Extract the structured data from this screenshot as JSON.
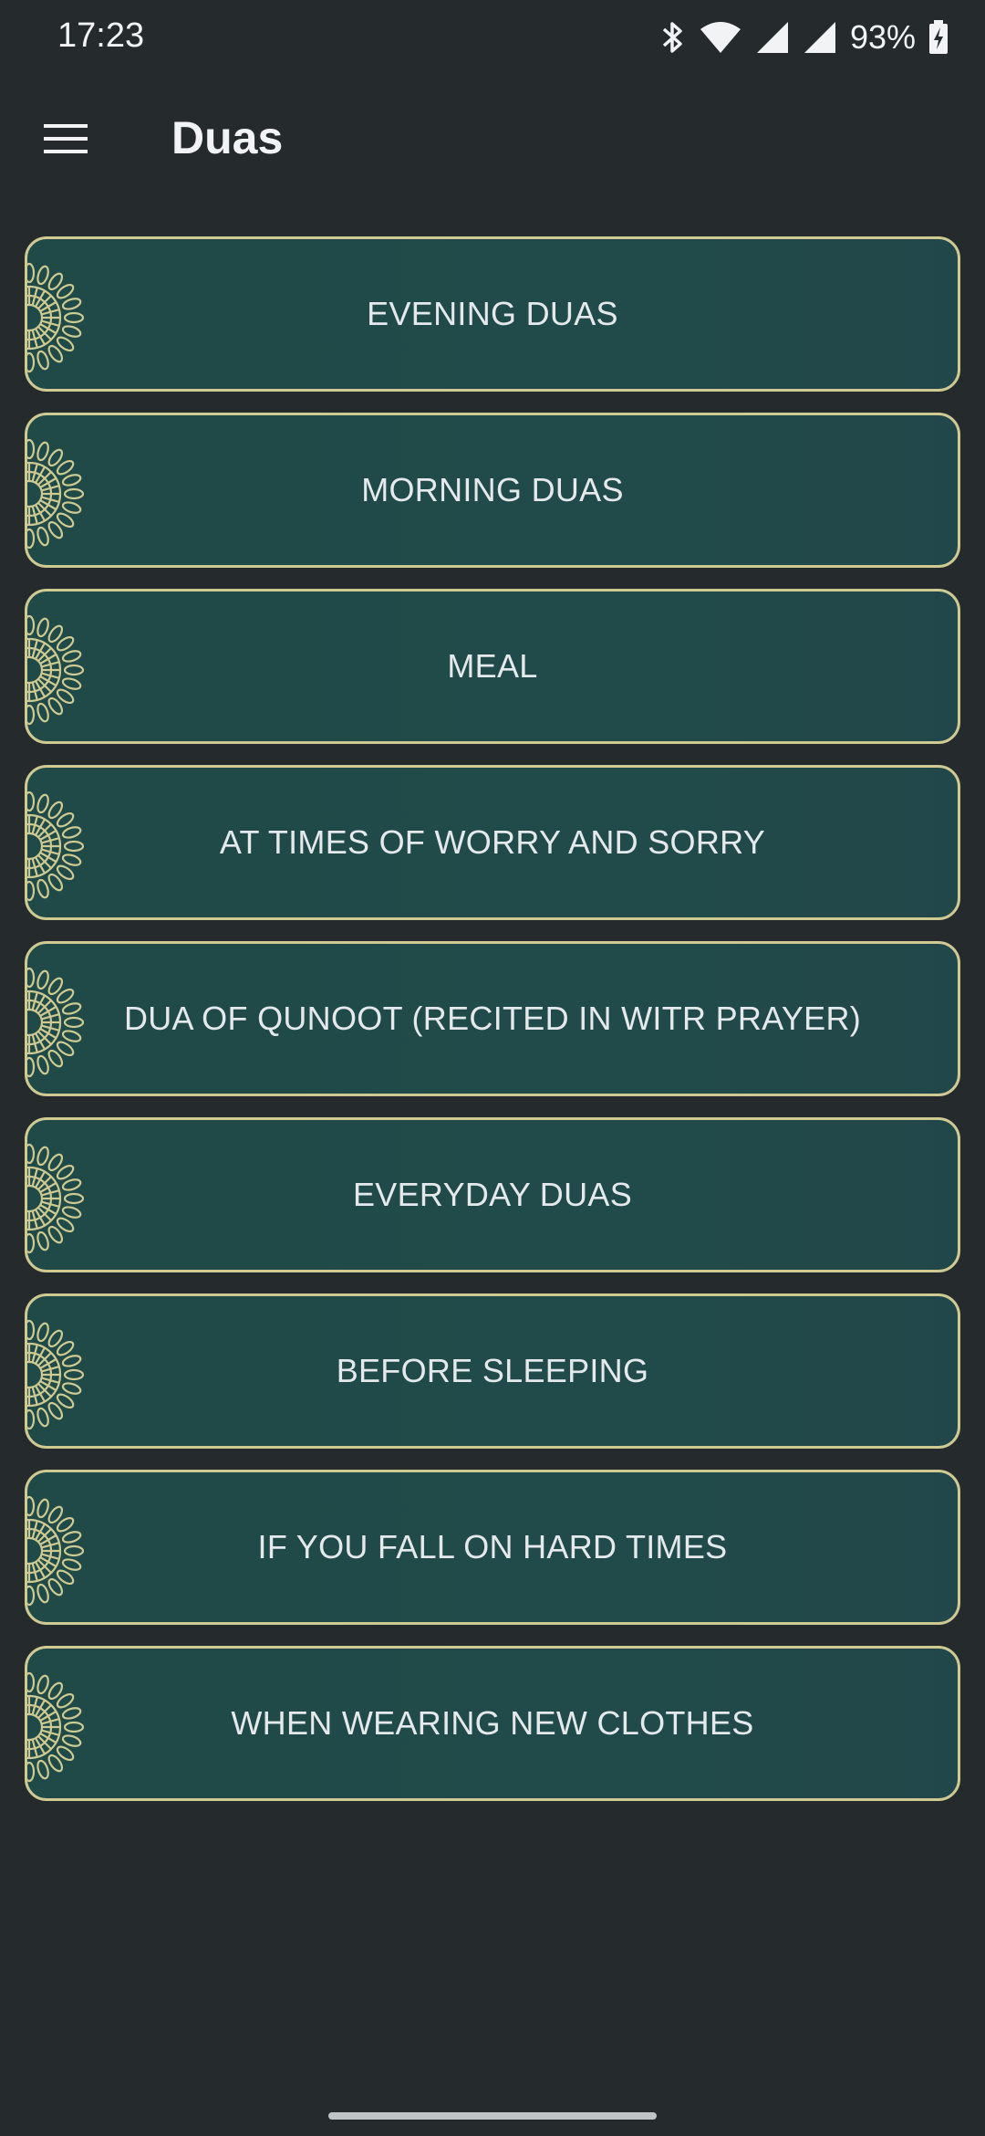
{
  "status_bar": {
    "time": "17:23",
    "battery_percent": "93%",
    "icons": [
      "bluetooth-icon",
      "wifi-icon",
      "signal-icon",
      "signal-icon-2",
      "battery-charging-icon"
    ]
  },
  "app_bar": {
    "menu_icon": "hamburger-menu-icon",
    "title": "Duas"
  },
  "colors": {
    "background": "#252a2d",
    "card_fill": "#204a48",
    "card_border": "#cfc992",
    "ornament": "#cfc992",
    "text": "#e6e9eb"
  },
  "duas": [
    {
      "label": "EVENING DUAS"
    },
    {
      "label": "MORNING DUAS"
    },
    {
      "label": "MEAL"
    },
    {
      "label": "AT TIMES OF WORRY AND SORRY"
    },
    {
      "label": "DUA OF QUNOOT (RECITED IN WITR PRAYER)"
    },
    {
      "label": "EVERYDAY DUAS"
    },
    {
      "label": "BEFORE SLEEPING"
    },
    {
      "label": "IF YOU FALL ON HARD TIMES"
    },
    {
      "label": "WHEN WEARING NEW CLOTHES"
    }
  ]
}
